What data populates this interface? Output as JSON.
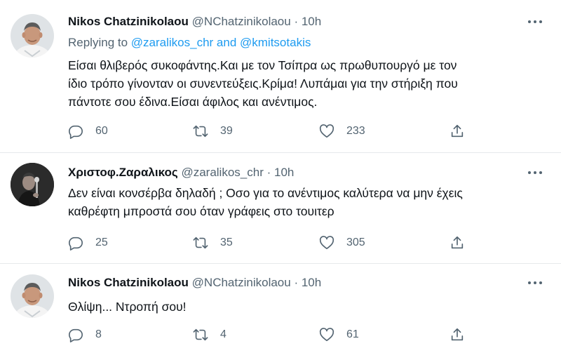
{
  "tweets": [
    {
      "name": "Nikos Chatzinikolaou",
      "handle": "@NChatzinikolaou",
      "dot": "·",
      "time": "10h",
      "reply_prefix": "Replying to",
      "reply_mentions": "@zaralikos_chr and @kmitsotakis",
      "text_lines": [
        "Είσαι θλιβερός συκοφάντης.Και με τον Τσίπρα ως πρωθυπουργό με τον",
        "ίδιο τρόπο γίνονταν οι συνεντεύξεις.Κρίμα! Λυπάμαι για την στήριξη που",
        "πάντοτε σου έδινα.Είσαι άφιλος και ανέντιμος."
      ],
      "replies": "60",
      "retweets": "39",
      "likes": "233"
    },
    {
      "name": "Χριστοφ.Ζαραλικος",
      "handle": "@zaralikos_chr",
      "dot": "·",
      "time": "10h",
      "text_lines": [
        "Δεν είναι κονσέρβα δηλαδή ; Οσο για το ανέντιμος καλύτερα να μην έχεις",
        "καθρέφτη μπροστά σου όταν γράφεις στο τουιτερ"
      ],
      "replies": "25",
      "retweets": "35",
      "likes": "305"
    },
    {
      "name": "Nikos Chatzinikolaou",
      "handle": "@NChatzinikolaou",
      "dot": "·",
      "time": "10h",
      "text_lines": [
        "Θλίψη... Ντροπή σου!"
      ],
      "replies": "8",
      "retweets": "4",
      "likes": "61"
    }
  ],
  "icons": {
    "reply": "reply-icon",
    "retweet": "retweet-icon",
    "like": "heart-icon",
    "share": "share-icon",
    "more": "more-icon"
  },
  "colors": {
    "text": "#0f1419",
    "secondary": "#536471",
    "mention": "#1d9bf0",
    "divider": "#e6e9eb"
  }
}
